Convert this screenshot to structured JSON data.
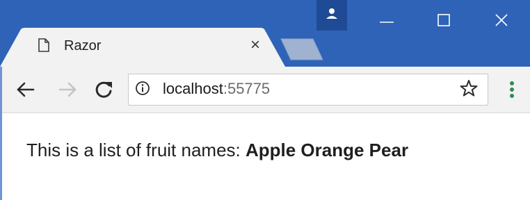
{
  "window": {
    "tab_title": "Razor",
    "tab_close_glyph": "×",
    "controls": {
      "minimize_icon": "minimize-icon",
      "maximize_icon": "maximize-icon",
      "close_icon": "close-icon"
    },
    "profile_icon": "person-icon"
  },
  "toolbar": {
    "back_icon": "arrow-left-icon",
    "forward_icon": "arrow-right-icon",
    "reload_icon": "reload-icon",
    "info_icon": "info-icon",
    "address": {
      "host": "localhost",
      "port": ":55775"
    },
    "bookmark_icon": "star-icon",
    "menu_icon": "kebab-menu-icon"
  },
  "page": {
    "intro": "This is a list of fruit names: ",
    "fruits": "Apple Orange Pear"
  },
  "colors": {
    "titlebar": "#2f63b7",
    "profile": "#1f4b96",
    "toolbar": "#f2f2f2",
    "menu_dots": "#2e8b57"
  }
}
